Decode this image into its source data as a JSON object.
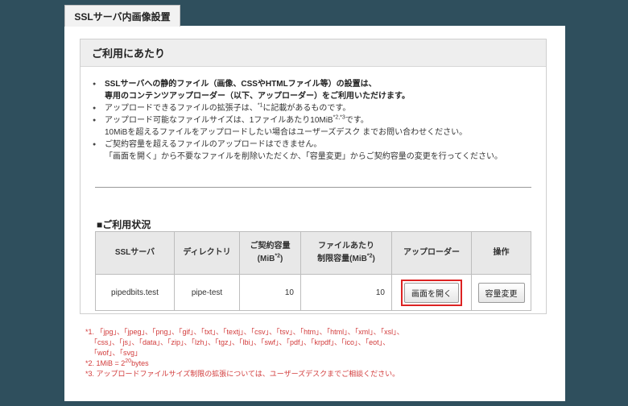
{
  "tab": {
    "label": "SSLサーバ内画像設置"
  },
  "panel": {
    "title": "ご利用にあたり",
    "notes": [
      {
        "lines": [
          "SSLサーバへの静的ファイル（画像、CSSやHTMLファイル等）の設置は、",
          "専用のコンテンツアップローダー（以下、アップローダー）をご利用いただけます。"
        ]
      },
      {
        "text_pre": "アップロードできるファイルの拡張子は、",
        "sup": "*1",
        "text_post": "に記載があるものです。"
      },
      {
        "text_pre": "アップロード可能なファイルサイズは、1ファイルあたり10MiB",
        "sup": "*2,*3",
        "text_post": "です。",
        "line2": "10MiBを超えるファイルをアップロードしたい場合はユーザーズデスク までお問い合わせください。"
      },
      {
        "lines": [
          "ご契約容量を超えるファイルのアップロードはできません。",
          "「画面を開く」から不要なファイルを削除いただくか、「容量変更」からご契約容量の変更を行ってください。"
        ]
      }
    ],
    "usage_title": "■ご利用状況",
    "table": {
      "headers": {
        "server": "SSLサーバ",
        "directory": "ディレクトリ",
        "capacity_l1": "ご契約容量",
        "capacity_l2": "(MiB",
        "capacity_sup": "*2",
        "capacity_l3": ")",
        "limit_l1": "ファイルあたり",
        "limit_l2": "制限容量(MiB",
        "limit_sup": "*2",
        "limit_l3": ")",
        "uploader": "アップローダー",
        "operation": "操作"
      },
      "row": {
        "server": "pipedbits.test",
        "directory": "pipe-test",
        "capacity": "10",
        "limit": "10",
        "open_button": "画面を開く",
        "change_button": "容量変更"
      }
    }
  },
  "footnotes": {
    "n1_l1": "*1. 「jpg」、「jpeg」、「png」、「gif」、「txt」、「textj」、「csv」、「tsv」、「htm」、「html」、「xml」、「xsl」、",
    "n1_l2": "「css」、「js」、「data」、「zip」、「lzh」、「tgz」、「lbi」、「swf」、「pdf」、「krpdf」、「ico」、「eot」、",
    "n1_l3": "「wof」、「svg」",
    "n2_pre": "*2. 1MiB = 2",
    "n2_sup": "20",
    "n2_post": "bytes",
    "n3": "*3. アップロードファイルサイズ制限の拡張については、ユーザーズデスクまでご相談ください。"
  },
  "colors": {
    "frame": "#2f4f5d",
    "footnote_red": "#d23b3b",
    "highlight_red": "#dd2222"
  }
}
